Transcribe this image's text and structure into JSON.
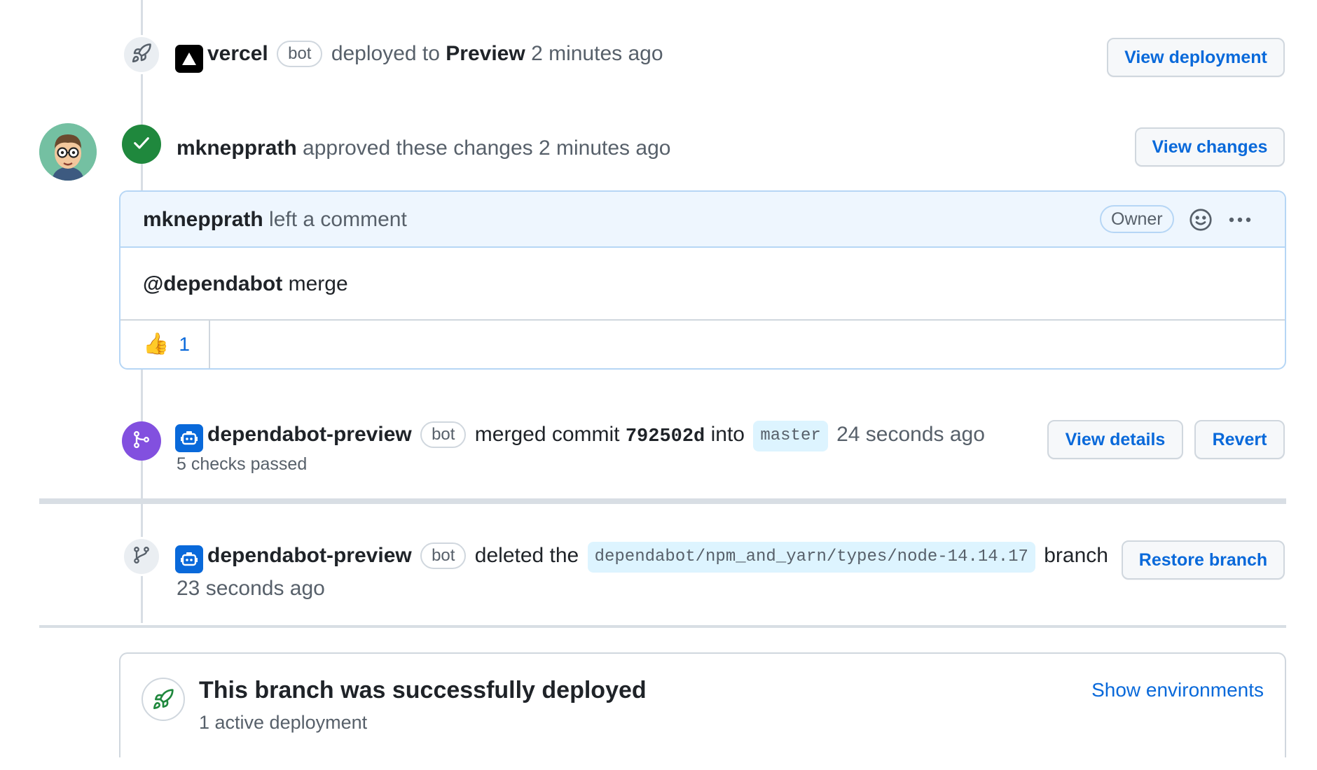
{
  "events": {
    "deploy": {
      "icon": "rocket-icon",
      "app_icon": "vercel-triangle-icon",
      "author": "vercel",
      "bot_label": "bot",
      "action": "deployed to",
      "environment": "Preview",
      "time": "2 minutes ago",
      "button": "View deployment"
    },
    "approval": {
      "icon": "check-icon",
      "author": "mknepprath",
      "action": "approved these changes",
      "time": "2 minutes ago",
      "button": "View changes"
    },
    "comment": {
      "author": "mknepprath",
      "action": "left a comment",
      "role": "Owner",
      "mention": "@dependabot",
      "body": "merge",
      "reaction_emoji": "👍",
      "reaction_count": "1"
    },
    "merge": {
      "icon": "merge-icon",
      "app_icon": "dependabot-icon",
      "author": "dependabot-preview",
      "bot_label": "bot",
      "action": "merged commit",
      "commit": "792502d",
      "into": "into",
      "branch": "master",
      "time": "24 seconds ago",
      "checks": "5 checks passed",
      "button_details": "View details",
      "button_revert": "Revert"
    },
    "delete_branch": {
      "icon": "git-branch-icon",
      "app_icon": "dependabot-icon",
      "author": "dependabot-preview",
      "bot_label": "bot",
      "action": "deleted the",
      "branch": "dependabot/npm_and_yarn/types/node-14.14.17",
      "suffix": "branch",
      "time": "23 seconds ago",
      "button": "Restore branch"
    }
  },
  "deployment_summary": {
    "icon": "rocket-icon",
    "title": "This branch was successfully deployed",
    "subtitle": "1 active deployment",
    "link": "Show environments"
  },
  "colors": {
    "accent": "#0969da",
    "success": "#1f883d",
    "merged": "#8250df",
    "border": "#d0d7de",
    "comment_header": "#ddf4ff"
  }
}
